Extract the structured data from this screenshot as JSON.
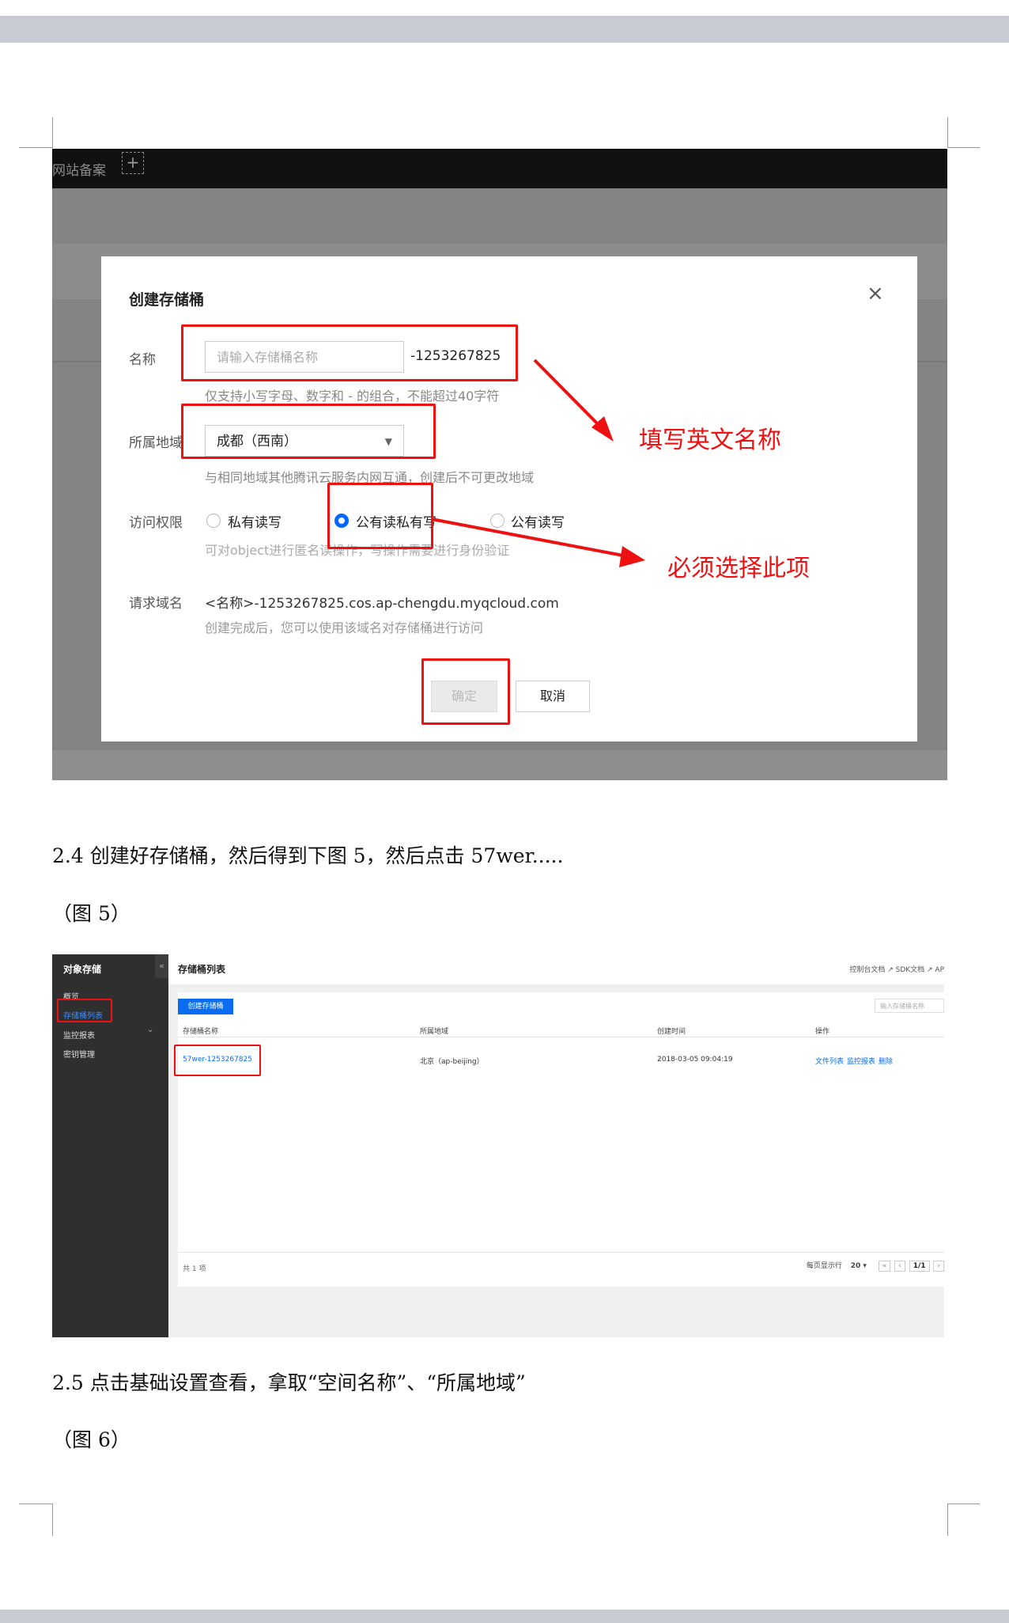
{
  "colors": {
    "accent_blue": "#0066ff",
    "annotation_red": "#e11111",
    "page_band": "#c9cbd3"
  },
  "figure1": {
    "topbar": {
      "text": "网站备案",
      "plus_icon": "+"
    },
    "dialog": {
      "title": "创建存储桶",
      "close_icon": "×",
      "name": {
        "label": "名称",
        "placeholder": "请输入存储桶名称",
        "suffix": "-1253267825",
        "hint": "仅支持小写字母、数字和 - 的组合，不能超过40字符"
      },
      "region": {
        "label": "所属地域",
        "value": "成都（西南）",
        "caret_icon": "▼",
        "hint": "与相同地域其他腾讯云服务内网互通，创建后不可更改地域"
      },
      "permission": {
        "label": "访问权限",
        "options": [
          {
            "label": "私有读写",
            "selected": false
          },
          {
            "label": "公有读私有写",
            "selected": true
          },
          {
            "label": "公有读写",
            "selected": false
          }
        ],
        "hint": "可对object进行匿名读操作，写操作需要进行身份验证"
      },
      "domain": {
        "label": "请求域名",
        "value": "<名称>-1253267825.cos.ap-chengdu.myqcloud.com",
        "hint": "创建完成后，您可以使用该域名对存储桶进行访问"
      },
      "buttons": {
        "ok": "确定",
        "cancel": "取消"
      }
    },
    "annotations": {
      "name_note": "填写英文名称",
      "permission_note": "必须选择此项"
    }
  },
  "paragraph_1": "2.4 创建好存储桶，然后得到下图 5，然后点击 57wer.....",
  "caption_5": "（图 5）",
  "figure2": {
    "sidebar": {
      "title": "对象存储",
      "collapse_icon": "«",
      "items": [
        "概览",
        "存储桶列表",
        "监控报表",
        "密钥管理"
      ],
      "expand_icon": "⌄"
    },
    "header": {
      "title": "存储桶列表",
      "links": "控制台文档 ↗   SDK文档 ↗   AP"
    },
    "create_button": "创建存储桶",
    "search_placeholder": "输入存储桶名称",
    "table": {
      "columns": [
        "存储桶名称",
        "所属地域",
        "创建时间",
        "操作"
      ],
      "rows": [
        {
          "name": "57wer-1253267825",
          "region": "北京（ap-beijing）",
          "created": "2018-03-05 09:04:19",
          "actions": [
            "文件列表",
            "监控报表",
            "删除"
          ]
        }
      ]
    },
    "footer": {
      "total": "共 1 项",
      "per_page_label": "每页显示行",
      "per_page": "20 ▾",
      "page": "1/1"
    }
  },
  "paragraph_2": "2.5 点击基础设置查看，拿取“空间名称”、“所属地域”",
  "caption_6": "（图 6）"
}
